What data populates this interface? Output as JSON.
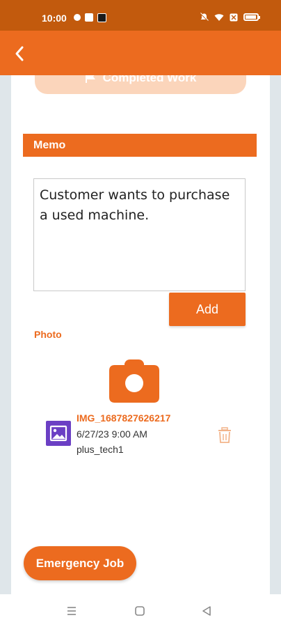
{
  "status_bar": {
    "time": "10:00"
  },
  "colors": {
    "accent": "#ec6b1f",
    "status_bar": "#c25a0d",
    "faded_button": "#fbd5bb",
    "photo_icon": "#6b3fc4"
  },
  "app_bar": {
    "back_icon": "chevron-left-icon"
  },
  "top_button": {
    "label": "Completed Work",
    "icon": "flag-icon"
  },
  "memo": {
    "header": "Memo",
    "text": "Customer wants to purchase a used machine.",
    "add_label": "Add"
  },
  "photo": {
    "label": "Photo",
    "camera_icon": "camera-icon",
    "items": [
      {
        "name": "IMG_1687827626217",
        "date": "6/27/23 9:00 AM",
        "user": "plus_tech1",
        "icon": "image-icon",
        "delete_icon": "trash-icon"
      }
    ]
  },
  "emergency": {
    "label": "Emergency Job"
  },
  "nav_bar": {
    "items": [
      "menu-icon",
      "home-icon",
      "back-icon"
    ]
  }
}
